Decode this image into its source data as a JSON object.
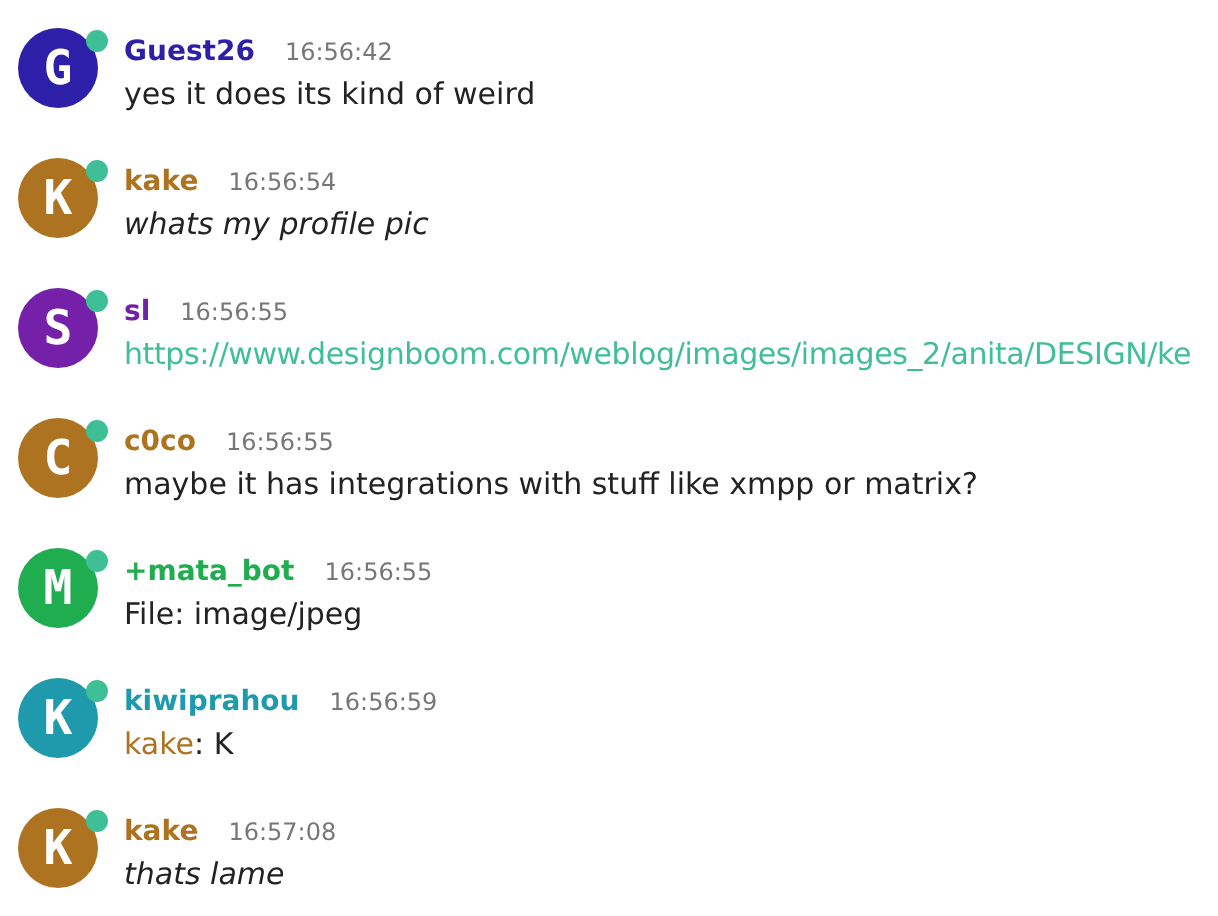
{
  "messages": [
    {
      "initial": "G",
      "author": "Guest26",
      "color": "#2e1fa8",
      "online": true,
      "time": "16:56:42",
      "kind": "text",
      "body": "yes it does its kind of weird"
    },
    {
      "initial": "K",
      "author": "kake",
      "color": "#ad7320",
      "online": true,
      "time": "16:56:54",
      "kind": "emote",
      "body": "whats my profile pic"
    },
    {
      "initial": "S",
      "author": "sl",
      "color": "#7420a8",
      "online": true,
      "time": "16:56:55",
      "kind": "link",
      "body": "https://www.designboom.com/weblog/images/images_2/anita/DESIGN/ke"
    },
    {
      "initial": "C",
      "author": "c0co",
      "color": "#ad7320",
      "online": true,
      "time": "16:56:55",
      "kind": "text",
      "body": "maybe it has integrations with stuff like xmpp or matrix?"
    },
    {
      "initial": "M",
      "author": "+mata_bot",
      "color": "#1fad4f",
      "online": true,
      "time": "16:56:55",
      "kind": "text",
      "body": "File: image/jpeg"
    },
    {
      "initial": "K",
      "author": "kiwiprahou",
      "color": "#1f9aad",
      "online": true,
      "time": "16:56:59",
      "kind": "mention",
      "mention": {
        "name": "kake",
        "color": "#ad7320"
      },
      "body": ": K"
    },
    {
      "initial": "K",
      "author": "kake",
      "color": "#ad7320",
      "online": true,
      "time": "16:57:08",
      "kind": "emote",
      "body": "thats lame"
    }
  ]
}
